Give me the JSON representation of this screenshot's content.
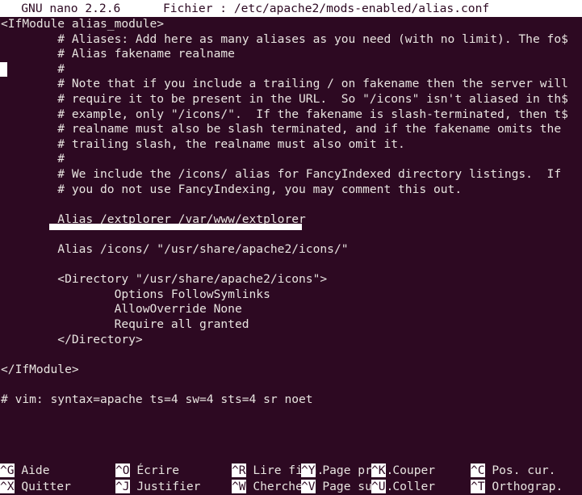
{
  "terminal": {
    "background_color": "#2d0922",
    "foreground_color": "#e8e4e0",
    "inverse_background": "#ffffff",
    "inverse_foreground": "#2d0922",
    "columns": 80,
    "rows": 33
  },
  "titlebar": {
    "program": "GNU nano 2.2.6",
    "file_label": "Fichier :",
    "file_path": "/etc/apache2/mods-enabled/alias.conf",
    "full_text": "  GNU nano 2.2.6      Fichier : /etc/apache2/mods-enabled/alias.conf"
  },
  "editor": {
    "lines": [
      "<IfModule alias_module>",
      "        # Aliases: Add here as many aliases as you need (with no limit). The fo$",
      "        # Alias fakename realname",
      "        #",
      "        # Note that if you include a trailing / on fakename then the server will",
      "        # require it to be present in the URL.  So \"/icons\" isn't aliased in th$",
      "        # example, only \"/icons/\".  If the fakename is slash-terminated, then t$",
      "        # realname must also be slash terminated, and if the fakename omits the",
      "        # trailing slash, the realname must also omit it.",
      "        #",
      "        # We include the /icons/ alias for FancyIndexed directory listings.  If",
      "        # you do not use FancyIndexing, you may comment this out.",
      "",
      "        Alias /extplorer /var/www/extplorer",
      "",
      "        Alias /icons/ \"/usr/share/apache2/icons/\"",
      "",
      "        <Directory \"/usr/share/apache2/icons\">",
      "                Options FollowSymlinks",
      "                AllowOverride None",
      "                Require all granted",
      "        </Directory>",
      "",
      "</IfModule>",
      "",
      "# vim: syntax=apache ts=4 sw=4 sts=4 sr noet"
    ],
    "cursor": {
      "row": 3,
      "column": 0
    },
    "annotation": {
      "type": "highlight-underline",
      "target_line_index": 13,
      "color": "#ffffff"
    }
  },
  "helpbar": {
    "row1": [
      {
        "key": "^G",
        "label": "Aide"
      },
      {
        "key": "^O",
        "label": "Écrire"
      },
      {
        "key": "^R",
        "label": "Lire fich."
      },
      {
        "key": "^Y",
        "label": "Page préc."
      },
      {
        "key": "^K",
        "label": "Couper"
      },
      {
        "key": "^C",
        "label": "Pos. cur."
      }
    ],
    "row2": [
      {
        "key": "^X",
        "label": "Quitter"
      },
      {
        "key": "^J",
        "label": "Justifier"
      },
      {
        "key": "^W",
        "label": "Chercher"
      },
      {
        "key": "^V",
        "label": "Page suiv."
      },
      {
        "key": "^U",
        "label": "Coller"
      },
      {
        "key": "^T",
        "label": "Orthograp."
      }
    ]
  }
}
